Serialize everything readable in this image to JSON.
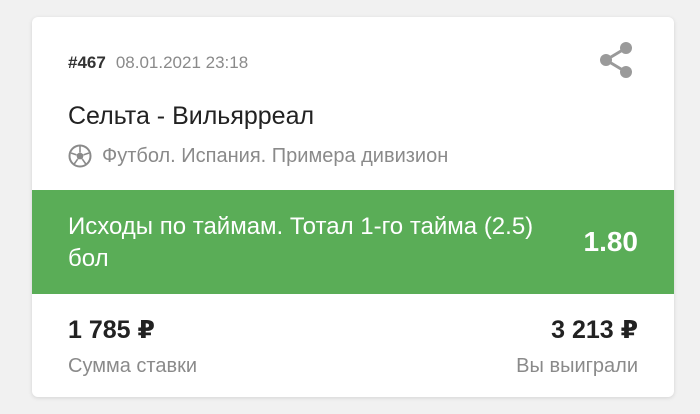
{
  "bet": {
    "id": "#467",
    "datetime": "08.01.2021 23:18",
    "match": "Сельта - Вильярреал",
    "sport_line": "Футбол. Испания. Примера дивизион",
    "outcome": "Исходы по таймам. Тотал 1-го тайма (2.5) бол",
    "odds": "1.80"
  },
  "amounts": {
    "stake": "1 785 ₽",
    "stake_label": "Сумма ставки",
    "win": "3 213 ₽",
    "win_label": "Вы выиграли"
  },
  "icons": {
    "share": "share-icon",
    "sport": "soccer-ball-icon"
  },
  "colors": {
    "accent_green": "#5aad57",
    "text_dark": "#222222",
    "text_muted": "#8a8a8a"
  }
}
